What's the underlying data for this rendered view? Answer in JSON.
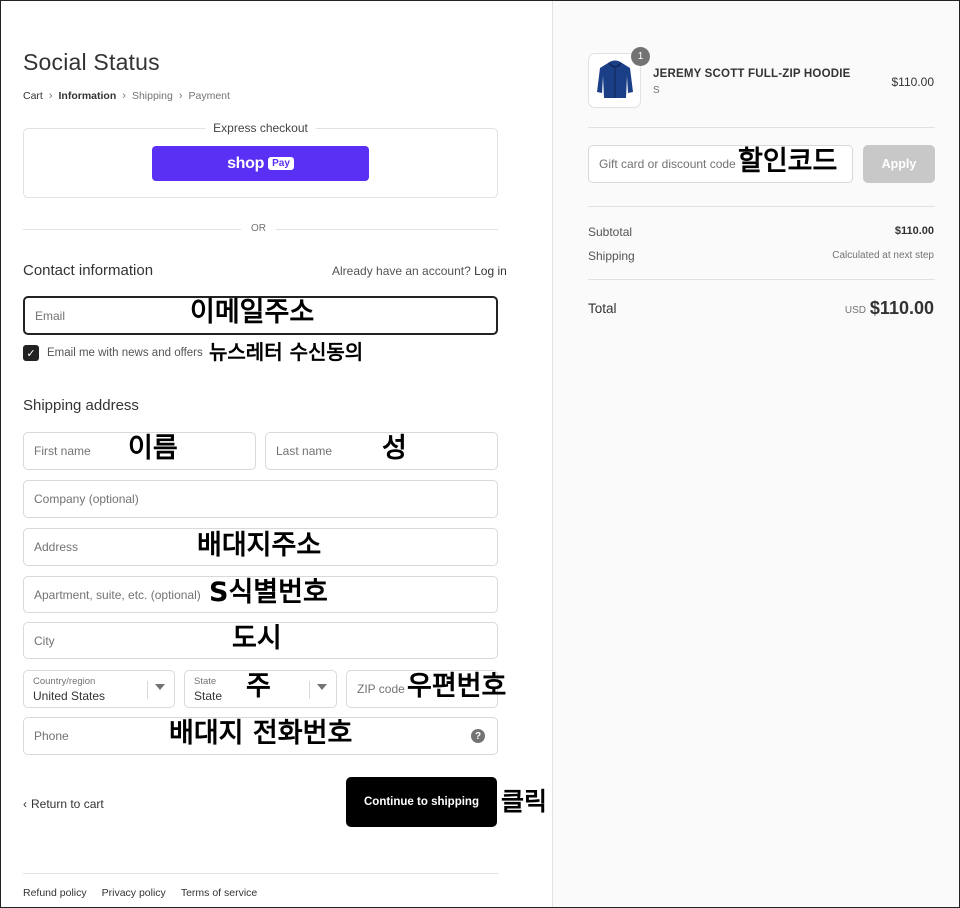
{
  "checkout": {
    "brand": "Social Status",
    "breadcrumbs": [
      "Cart",
      "Information",
      "Shipping",
      "Payment"
    ],
    "express": {
      "label": "Express checkout",
      "shop": "shop",
      "pay": "Pay"
    },
    "or": "OR",
    "contact": {
      "title": "Contact information",
      "account_hint": "Already have an account?",
      "login": "Log in",
      "email_placeholder": "Email",
      "newsletter": "Email me with news and offers"
    },
    "shipping": {
      "title": "Shipping address",
      "first_name": "First name",
      "last_name": "Last name",
      "company": "Company (optional)",
      "address": "Address",
      "apartment": "Apartment, suite, etc. (optional)",
      "city": "City",
      "country_label": "Country/region",
      "country_value": "United States",
      "state_label": "State",
      "state_value": "State",
      "zip": "ZIP code",
      "phone": "Phone"
    },
    "actions": {
      "back": "Return to cart",
      "continue": "Continue to shipping"
    },
    "footer": [
      "Refund policy",
      "Privacy policy",
      "Terms of service"
    ]
  },
  "summary": {
    "product": {
      "name": "JEREMY SCOTT FULL-ZIP HOODIE",
      "variant": "S",
      "price": "$110.00",
      "quantity": "1"
    },
    "discount_placeholder": "Gift card or discount code",
    "apply": "Apply",
    "subtotal_label": "Subtotal",
    "subtotal_value": "$110.00",
    "shipping_label": "Shipping",
    "shipping_value": "Calculated at next step",
    "total_label": "Total",
    "total_currency": "USD",
    "total_value": "$110.00"
  },
  "annotations": {
    "discount": "할인코드",
    "email": "이메일주소",
    "newsletter": "뉴스레터 수신동의",
    "first_name": "이름",
    "last_name": "성",
    "address": "배대지주소",
    "apartment": "S식별번호",
    "city": "도시",
    "state": "주",
    "zip": "우편번호",
    "phone": "배대지 전화번호",
    "click": "클릭"
  },
  "colors": {
    "shop_pay": "#5a31f4",
    "primary_button": "#000000",
    "apply_disabled": "#c8c8c8"
  }
}
